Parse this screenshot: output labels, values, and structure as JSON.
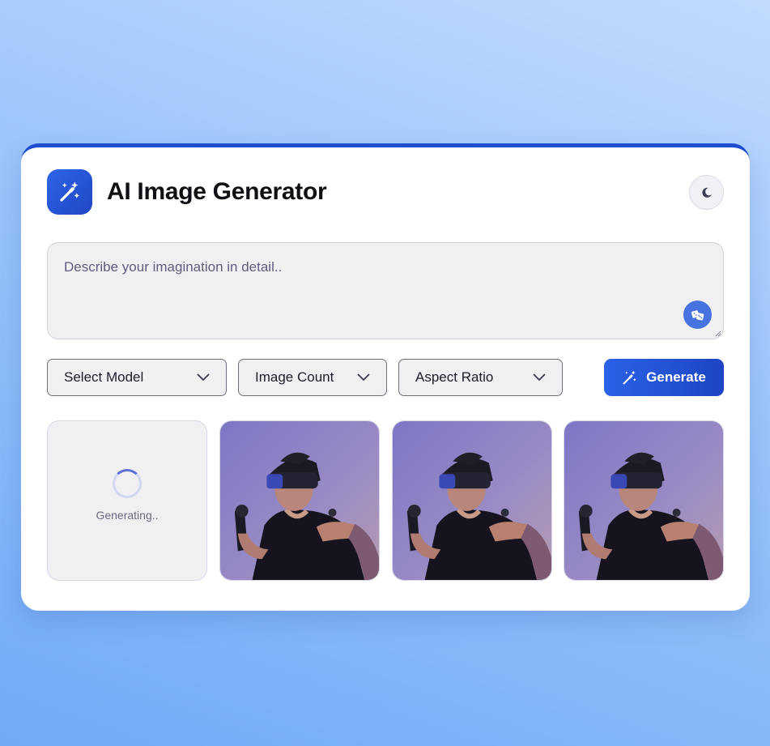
{
  "app": {
    "title": "AI Image Generator",
    "logo_icon": "magic-wand-sparkles-icon",
    "theme_toggle_icon": "moon-icon"
  },
  "prompt": {
    "placeholder": "Describe your imagination in detail..",
    "value": "",
    "random_prompt_icon": "dice-icon"
  },
  "controls": {
    "model_select": {
      "label": "Select Model",
      "icon": "chevron-down-icon"
    },
    "count_select": {
      "label": "Image Count",
      "icon": "chevron-down-icon"
    },
    "ratio_select": {
      "label": "Aspect Ratio",
      "icon": "chevron-down-icon"
    },
    "generate_button": {
      "label": "Generate",
      "icon": "magic-wand-icon"
    }
  },
  "gallery": {
    "items": [
      {
        "state": "loading",
        "status_text": "Generating.."
      },
      {
        "state": "done",
        "description": "man wearing VR headset holding controllers"
      },
      {
        "state": "done",
        "description": "man wearing VR headset holding controllers"
      },
      {
        "state": "done",
        "description": "man wearing VR headset holding controllers"
      }
    ]
  },
  "colors": {
    "accent": "#1e4fd1",
    "button_gradient_start": "#2a62e8",
    "button_gradient_end": "#1d44c3",
    "photo_background": "#8a80c2"
  }
}
